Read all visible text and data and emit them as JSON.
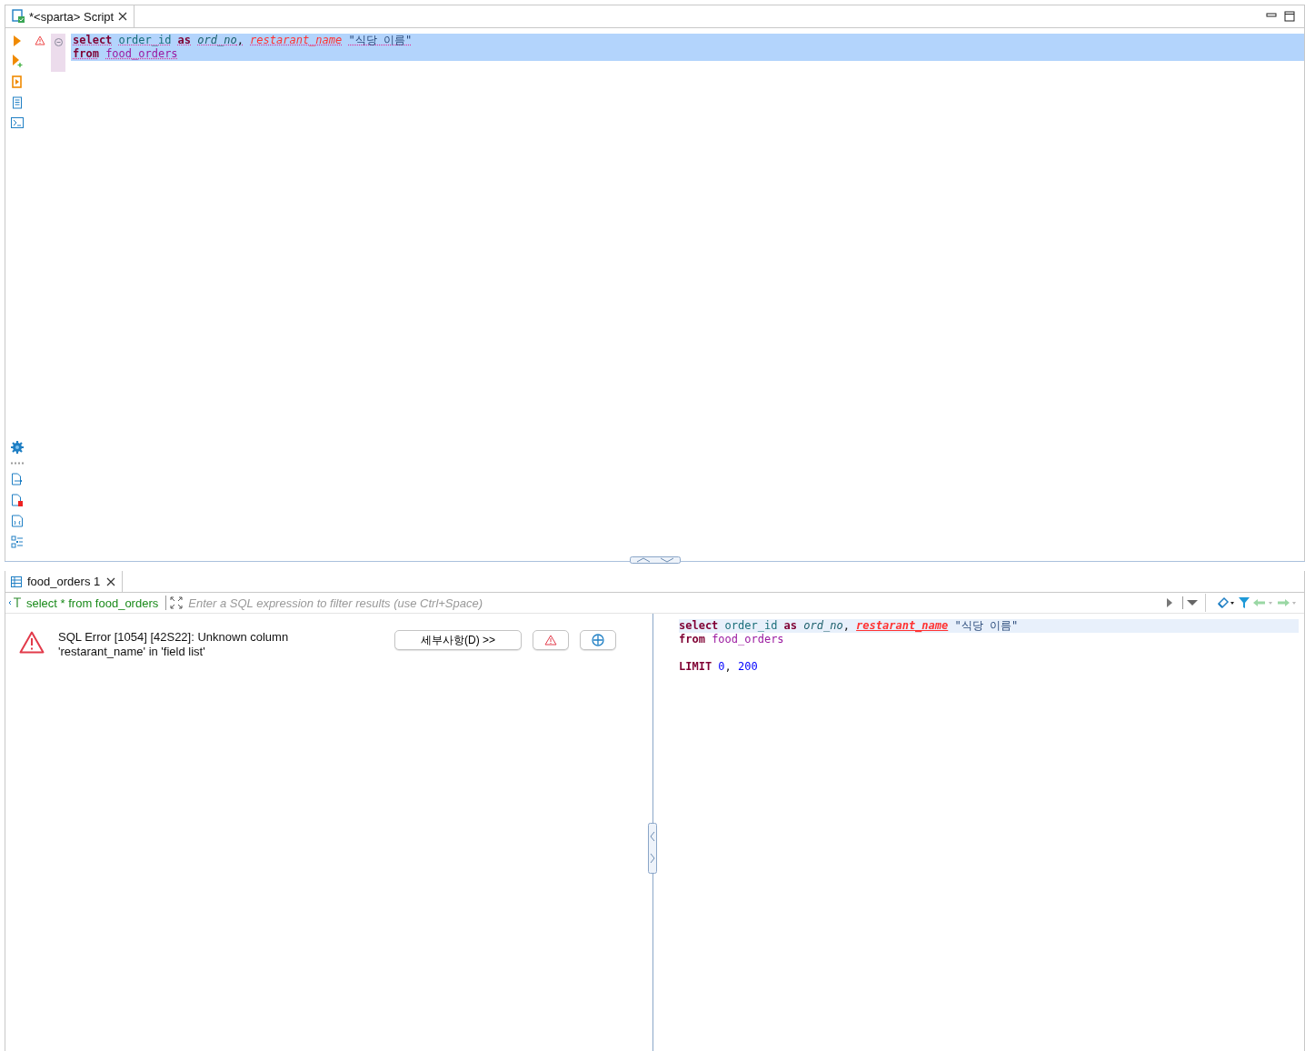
{
  "editor_tab": {
    "title": "*<sparta> Script"
  },
  "editor": {
    "lines": [
      {
        "highlighted": true,
        "tokens": [
          {
            "kind": "keyword",
            "text": "select",
            "spaced": false
          },
          {
            "kind": "column",
            "text": "order_id",
            "spaced": true
          },
          {
            "kind": "keyword",
            "text": "as",
            "spaced": true
          },
          {
            "kind": "alias",
            "text": "ord_no",
            "spaced": true
          },
          {
            "kind": "plain",
            "text": ",",
            "spaced": false
          },
          {
            "kind": "error",
            "text": "restarant_name",
            "spaced": true
          },
          {
            "kind": "string",
            "text": "\"식당 이름\"",
            "spaced": true
          }
        ]
      },
      {
        "highlighted": true,
        "tokens": [
          {
            "kind": "keyword",
            "text": "from",
            "spaced": false
          },
          {
            "kind": "table",
            "text": "food_orders",
            "spaced": true
          }
        ]
      }
    ]
  },
  "results_tab": {
    "title": "food_orders 1"
  },
  "filter": {
    "query": "select * from food_orders",
    "placeholder": "Enter a SQL expression to filter results (use Ctrl+Space)"
  },
  "error": {
    "message": "SQL Error [1054] [42S22]: Unknown column 'restarant_name' in 'field list'",
    "details_button": "세부사항(D) >>"
  },
  "query_text": {
    "lines": [
      {
        "kind": "code",
        "highlighted": true,
        "tokens": [
          {
            "kind": "keyword",
            "text": "select",
            "spaced": false
          },
          {
            "kind": "column",
            "text": "order_id",
            "spaced": true
          },
          {
            "kind": "keyword",
            "text": "as",
            "spaced": true
          },
          {
            "kind": "alias",
            "text": "ord_no",
            "spaced": true
          },
          {
            "kind": "plain",
            "text": ",",
            "spaced": false
          },
          {
            "kind": "error",
            "text": "restarant_name",
            "spaced": true
          },
          {
            "kind": "string",
            "text": "\"식당 이름\"",
            "spaced": true
          }
        ]
      },
      {
        "kind": "code",
        "highlighted": false,
        "tokens": [
          {
            "kind": "keyword",
            "text": "from",
            "spaced": false
          },
          {
            "kind": "table",
            "text": "food_orders",
            "spaced": true
          }
        ]
      },
      {
        "kind": "blank"
      },
      {
        "kind": "code",
        "highlighted": false,
        "tokens": [
          {
            "kind": "keyword",
            "text": "LIMIT",
            "spaced": false
          },
          {
            "kind": "number",
            "text": "0",
            "spaced": true
          },
          {
            "kind": "plain",
            "text": ",",
            "spaced": false
          },
          {
            "kind": "number",
            "text": "200",
            "spaced": true
          }
        ]
      }
    ]
  }
}
